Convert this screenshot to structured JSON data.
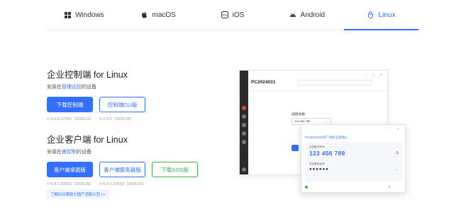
{
  "tabs": [
    {
      "label": "Windows",
      "icon": "windows-icon",
      "active": false
    },
    {
      "label": "macOS",
      "icon": "apple-icon",
      "active": false
    },
    {
      "label": "iOS",
      "icon": "ios-icon",
      "active": false
    },
    {
      "label": "Android",
      "icon": "android-icon",
      "active": false
    },
    {
      "label": "Linux",
      "icon": "linux-icon",
      "active": true
    }
  ],
  "controller": {
    "title": "企业控制端 for Linux",
    "sub_prefix": "安装在",
    "sub_link": "管理远控",
    "sub_suffix": "的设备",
    "buttons": [
      "下载控制端",
      "控制端CLI版"
    ],
    "versions": [
      "V 6.5.5.27062（2025.12）",
      "V 1.0.0（2026.06）"
    ]
  },
  "client": {
    "title": "企业客户端 for Linux",
    "sub_prefix": "安装在",
    "sub_link": "被控制",
    "sub_suffix": "的设备",
    "buttons": [
      "客户端桌面版",
      "客户端服务器版",
      "下载SOS版"
    ],
    "versions": [
      "V 5.8.1.29563（2026.06）",
      "V 5.8.1.29563（2026.06）"
    ]
  },
  "banner_link": "了解向日葵助力国产适配计划 »»",
  "preview_main": {
    "device_id": "PC2024031",
    "remote_label": "远程协助",
    "remote_input": "123 456 789"
  },
  "preview_client": {
    "device": "PC2024031的广州的卫号机II",
    "code_label": "本设备识别码",
    "code": "123 456 789",
    "pwd_label": "本设备验证码",
    "pwd": "●●●●●●"
  },
  "colors": {
    "accent": "#3370ff",
    "green": "#3fb24f"
  }
}
